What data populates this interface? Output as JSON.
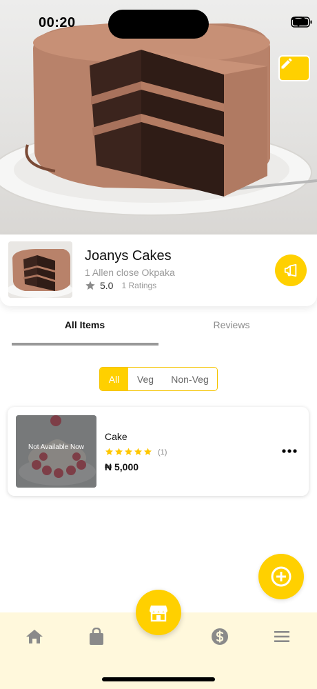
{
  "status_bar": {
    "time": "00:20"
  },
  "store": {
    "name": "Joanys Cakes",
    "address": "1 Allen close Okpaka",
    "rating": "5.0",
    "ratings_count": "1 Ratings"
  },
  "tabs": [
    {
      "label": "All Items",
      "active": true
    },
    {
      "label": "Reviews",
      "active": false
    }
  ],
  "filter": {
    "options": [
      "All",
      "Veg",
      "Non-Veg"
    ],
    "selected": "All"
  },
  "items": [
    {
      "name": "Cake",
      "stars": 5,
      "rating_count": "(1)",
      "price": "₦ 5,000",
      "availability": "Not Available Now"
    }
  ],
  "colors": {
    "accent": "#ffd000",
    "bottom_nav_bg": "#fff8dc",
    "nav_icon": "#8a8a8a"
  },
  "icons": {
    "edit": "pencil-icon",
    "promo": "megaphone-icon",
    "add": "plus-circle-icon",
    "nav": [
      "home-icon",
      "shopping-bag-icon",
      "store-icon",
      "dollar-icon",
      "menu-icon"
    ]
  }
}
